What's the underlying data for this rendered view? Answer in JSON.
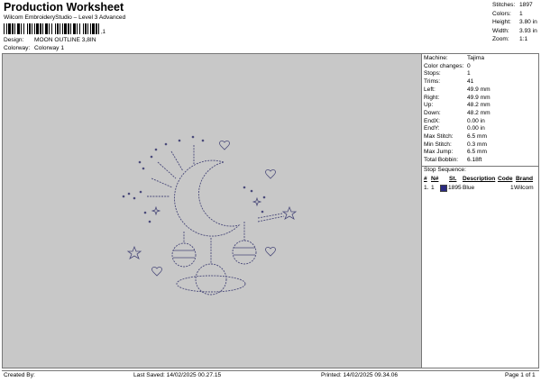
{
  "header": {
    "title": "Production Worksheet",
    "subtitle": "Wilcom EmbroideryStudio – Level 3 Advanced",
    "barcode_tail": ",1",
    "design_label": "Design:",
    "design_value": "MOON OUTLINE 3,8IN",
    "colorway_label": "Colorway:",
    "colorway_value": "Colorway 1"
  },
  "stats": [
    {
      "label": "Stitches:",
      "value": "1897"
    },
    {
      "label": "Colors:",
      "value": "1"
    },
    {
      "label": "Height:",
      "value": "3.80 in"
    },
    {
      "label": "Width:",
      "value": "3.93 in"
    },
    {
      "label": "Zoom:",
      "value": "1:1"
    }
  ],
  "machine_info": [
    {
      "label": "Machine:",
      "value": "Tajima"
    },
    {
      "label": "Color changes:",
      "value": "0"
    },
    {
      "label": "Stops:",
      "value": "1"
    },
    {
      "label": "Trims:",
      "value": "41"
    },
    {
      "label": "Left:",
      "value": "49.9 mm"
    },
    {
      "label": "Right:",
      "value": "49.9 mm"
    },
    {
      "label": "Up:",
      "value": "48.2 mm"
    },
    {
      "label": "Down:",
      "value": "48.2 mm"
    },
    {
      "label": "EndX:",
      "value": "0.00 in"
    },
    {
      "label": "EndY:",
      "value": "0.00 in"
    },
    {
      "label": "Max Stitch:",
      "value": "6.5 mm"
    },
    {
      "label": "Min Stitch:",
      "value": "0.3 mm"
    },
    {
      "label": "Max Jump:",
      "value": "6.5 mm"
    },
    {
      "label": "Total Bobbin:",
      "value": "6.18ft"
    }
  ],
  "stop_sequence": {
    "title": "Stop Sequence:",
    "columns": [
      "#",
      "N#",
      "St.",
      "Description",
      "Code",
      "Brand"
    ],
    "rows": [
      {
        "num": "1.",
        "needle": "1",
        "stitches": "1895",
        "description": "Blue",
        "code": "1",
        "brand": "Wilcom",
        "color": "#2a2a80"
      }
    ]
  },
  "design": {
    "thread_color": "#4a4a7a",
    "background": "#c8c8c8"
  },
  "footer": {
    "created_by": "Created By:",
    "last_saved": "Last Saved: 14/02/2025 00.27.15",
    "printed": "Printed: 14/02/2025 09.34.06",
    "page": "Page 1 of 1"
  }
}
